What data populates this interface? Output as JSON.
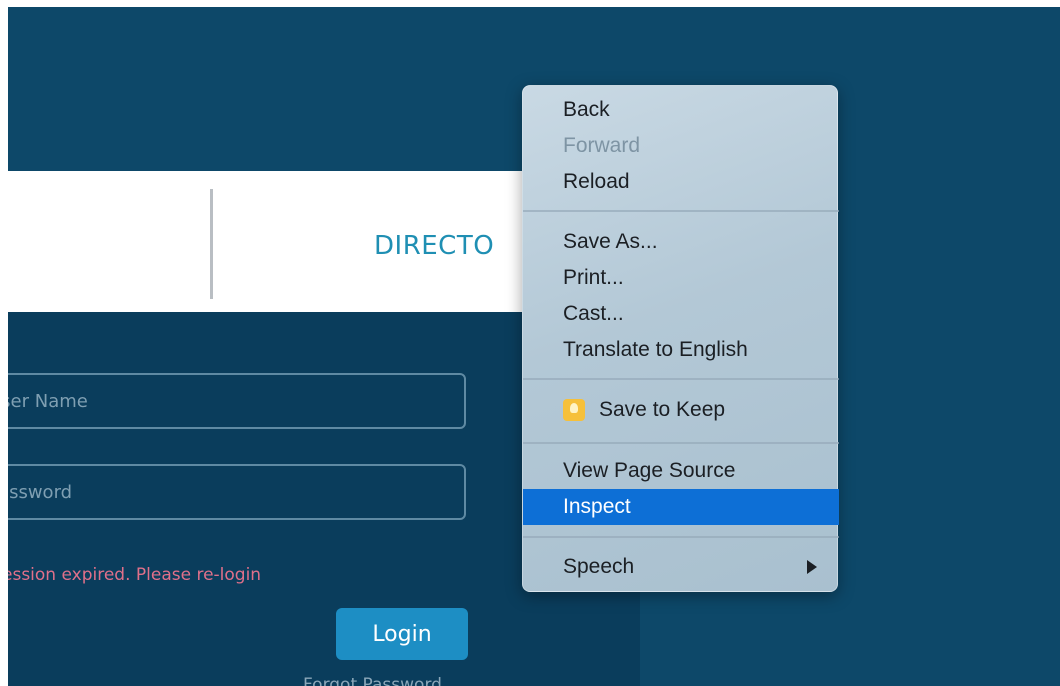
{
  "page": {
    "header_title": "DIRECTO",
    "username_placeholder": "User Name",
    "password_placeholder": "Password",
    "session_message": "ession expired. Please re-login",
    "login_label": "Login",
    "forgot_label": "Forgot Password"
  },
  "menu": {
    "items": [
      {
        "label": "Back",
        "enabled": true
      },
      {
        "label": "Forward",
        "enabled": false
      },
      {
        "label": "Reload",
        "enabled": true
      },
      {
        "label": "Save As...",
        "enabled": true
      },
      {
        "label": "Print...",
        "enabled": true
      },
      {
        "label": "Cast...",
        "enabled": true
      },
      {
        "label": "Translate to English",
        "enabled": true
      },
      {
        "label": "Save to Keep",
        "enabled": true,
        "icon": "keep-icon"
      },
      {
        "label": "View Page Source",
        "enabled": true
      },
      {
        "label": "Inspect",
        "enabled": true,
        "selected": true
      },
      {
        "label": "Speech",
        "enabled": true,
        "submenu": true
      }
    ],
    "colors": {
      "highlight": "#0d6fd6",
      "disabled_text": "#7e94a4"
    }
  },
  "colors": {
    "page_background": "#0d4869",
    "login_button": "#1d8ec4",
    "error_text": "#e0708a",
    "title_text": "#1f8fb3"
  }
}
